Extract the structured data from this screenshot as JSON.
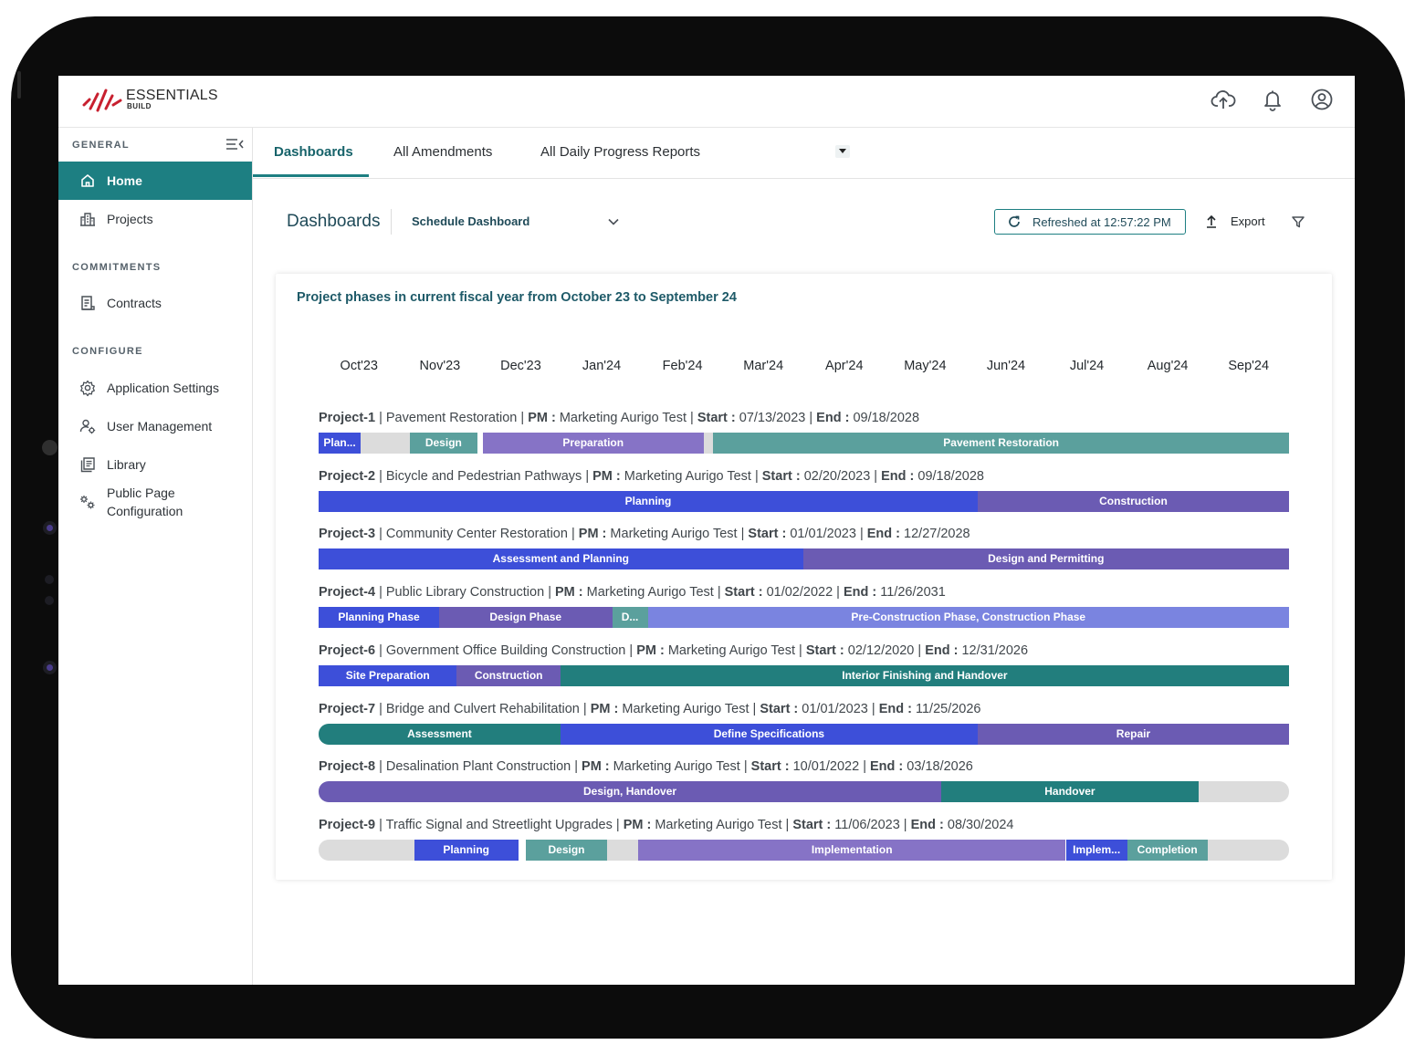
{
  "brand": {
    "name": "ESSENTIALS",
    "sub": "BUILD"
  },
  "header_icons": [
    "cloud-upload-icon",
    "bell-icon",
    "user-circle-icon"
  ],
  "sidebar": {
    "sections": [
      {
        "title": "GENERAL"
      },
      {
        "title": "COMMITMENTS"
      },
      {
        "title": "CONFIGURE"
      }
    ],
    "items": [
      {
        "label": "Home",
        "icon": "home-icon",
        "active": true
      },
      {
        "label": "Projects",
        "icon": "building-icon"
      },
      {
        "label": "Contracts",
        "icon": "document-icon"
      },
      {
        "label": "Application Settings",
        "icon": "gear-icon"
      },
      {
        "label": "User Management",
        "icon": "user-gear-icon"
      },
      {
        "label": "Library",
        "icon": "library-icon"
      },
      {
        "label_line1": "Public Page",
        "label_line2": "Configuration",
        "icon": "gears-icon"
      }
    ]
  },
  "tabs": [
    {
      "label": "Dashboards",
      "active": true
    },
    {
      "label": "All Amendments"
    },
    {
      "label": "All Daily Progress Reports"
    }
  ],
  "toolbar": {
    "title": "Dashboards",
    "selected_dashboard": "Schedule Dashboard",
    "refresh_label": "Refreshed at 12:57:22 PM",
    "export_label": "Export"
  },
  "colors": {
    "accent": "#1d7f82",
    "blue": "#3d4fd9",
    "purple": "#6b5bb3",
    "lavender": "#8673c6",
    "periwinkle": "#7a84e0",
    "teal": "#5ba09d",
    "dark_teal": "#227e7d",
    "gray": "#dcdcdc"
  },
  "chart_data": {
    "type": "gantt",
    "title": "Project phases in current fiscal year from October 23 to September 24",
    "months": [
      "Oct'23",
      "Nov'23",
      "Dec'23",
      "Jan'24",
      "Feb'24",
      "Mar'24",
      "Apr'24",
      "May'24",
      "Jun'24",
      "Jul'24",
      "Aug'24",
      "Sep'24"
    ],
    "start_label": "Start :",
    "end_label": "End :",
    "pm_label": "PM :",
    "projects": [
      {
        "id": "Project-1",
        "name": "Pavement Restoration",
        "pm": "Marketing Aurigo Test",
        "start": "07/13/2023",
        "end": "09/18/2028",
        "phases": [
          {
            "label": "Plan...",
            "from": 0.0,
            "to": 0.52,
            "color": "#3d4fd9"
          },
          {
            "label": "",
            "from": 0.52,
            "to": 1.13,
            "color": "#dcdcdc"
          },
          {
            "label": "Design",
            "from": 1.13,
            "to": 1.96,
            "color": "#5ba09d"
          },
          {
            "label": "",
            "from": 1.96,
            "to": 2.03,
            "color": "#ffffff"
          },
          {
            "label": "Preparation",
            "from": 2.03,
            "to": 4.76,
            "color": "#8673c6"
          },
          {
            "label": "",
            "from": 4.76,
            "to": 4.88,
            "color": "#dcdcdc"
          },
          {
            "label": "Pavement Restoration",
            "from": 4.88,
            "to": 12.0,
            "color": "#5ba09d"
          }
        ]
      },
      {
        "id": "Project-2",
        "name": "Bicycle and Pedestrian Pathways",
        "pm": "Marketing Aurigo Test",
        "start": "02/20/2023",
        "end": "09/18/2028",
        "phases": [
          {
            "label": "Planning",
            "from": 0.0,
            "to": 8.15,
            "color": "#3d4fd9"
          },
          {
            "label": "Construction",
            "from": 8.15,
            "to": 12.0,
            "color": "#6b5bb3"
          }
        ]
      },
      {
        "id": "Project-3",
        "name": "Community Center Restoration",
        "pm": "Marketing Aurigo Test",
        "start": "01/01/2023",
        "end": "12/27/2028",
        "phases": [
          {
            "label": "Assessment and Planning",
            "from": 0.0,
            "to": 5.99,
            "color": "#3d4fd9"
          },
          {
            "label": "Design and Permitting",
            "from": 5.99,
            "to": 12.0,
            "color": "#6b5bb3"
          }
        ]
      },
      {
        "id": "Project-4",
        "name": "Public Library Construction",
        "pm": "Marketing Aurigo Test",
        "start": "01/02/2022",
        "end": "11/26/2031",
        "phases": [
          {
            "label": "Planning Phase",
            "from": 0.0,
            "to": 1.49,
            "color": "#3d4fd9"
          },
          {
            "label": "Design Phase",
            "from": 1.49,
            "to": 3.63,
            "color": "#6b5bb3"
          },
          {
            "label": "D...",
            "from": 3.63,
            "to": 4.07,
            "color": "#5ba09d"
          },
          {
            "label": "Pre-Construction Phase, Construction Phase",
            "from": 4.07,
            "to": 12.0,
            "color": "#7a84e0"
          }
        ]
      },
      {
        "id": "Project-6",
        "name": "Government Office Building Construction",
        "pm": "Marketing Aurigo Test",
        "start": "02/12/2020",
        "end": "12/31/2026",
        "phases": [
          {
            "label": "Site Preparation",
            "from": 0.0,
            "to": 1.71,
            "color": "#3d4fd9"
          },
          {
            "label": "Construction",
            "from": 1.71,
            "to": 2.99,
            "color": "#6b5bb3"
          },
          {
            "label": "Interior Finishing and Handover",
            "from": 2.99,
            "to": 12.0,
            "color": "#227e7d"
          }
        ]
      },
      {
        "id": "Project-7",
        "name": "Bridge and Culvert Rehabilitation",
        "pm": "Marketing Aurigo Test",
        "start": "01/01/2023",
        "end": "11/25/2026",
        "phases": [
          {
            "label": "Assessment",
            "from": 0.0,
            "to": 2.99,
            "color": "#227e7d"
          },
          {
            "label": "Define Specifications",
            "from": 2.99,
            "to": 8.15,
            "color": "#3d4fd9"
          },
          {
            "label": "Repair",
            "from": 8.15,
            "to": 12.0,
            "color": "#6b5bb3"
          }
        ]
      },
      {
        "id": "Project-8",
        "name": "Desalination Plant Construction",
        "pm": "Marketing Aurigo Test",
        "start": "10/01/2022",
        "end": "03/18/2026",
        "phases": [
          {
            "label": "Design, Handover",
            "from": 0.0,
            "to": 7.7,
            "color": "#6b5bb3"
          },
          {
            "label": "Handover",
            "from": 7.7,
            "to": 10.88,
            "color": "#227e7d"
          },
          {
            "label": "",
            "from": 10.88,
            "to": 12.0,
            "color": "#dcdcdc"
          }
        ]
      },
      {
        "id": "Project-9",
        "name": "Traffic Signal and Streetlight Upgrades",
        "pm": "Marketing Aurigo Test",
        "start": "11/06/2023",
        "end": "08/30/2024",
        "phases": [
          {
            "label": "",
            "from": 0.0,
            "to": 1.18,
            "color": "#dcdcdc"
          },
          {
            "label": "Planning",
            "from": 1.18,
            "to": 2.47,
            "color": "#3d4fd9"
          },
          {
            "label": "",
            "from": 2.47,
            "to": 2.56,
            "color": "#ffffff"
          },
          {
            "label": "Design",
            "from": 2.56,
            "to": 3.57,
            "color": "#5ba09d"
          },
          {
            "label": "",
            "from": 3.57,
            "to": 3.95,
            "color": "#dcdcdc"
          },
          {
            "label": "Implementation",
            "from": 3.95,
            "to": 9.24,
            "color": "#8673c6"
          },
          {
            "label": "Implem...",
            "from": 9.24,
            "to": 10.0,
            "color": "#3d4fd9"
          },
          {
            "label": "Completion",
            "from": 10.0,
            "to": 10.99,
            "color": "#5ba09d"
          },
          {
            "label": "",
            "from": 10.99,
            "to": 12.0,
            "color": "#dcdcdc"
          }
        ]
      }
    ]
  }
}
